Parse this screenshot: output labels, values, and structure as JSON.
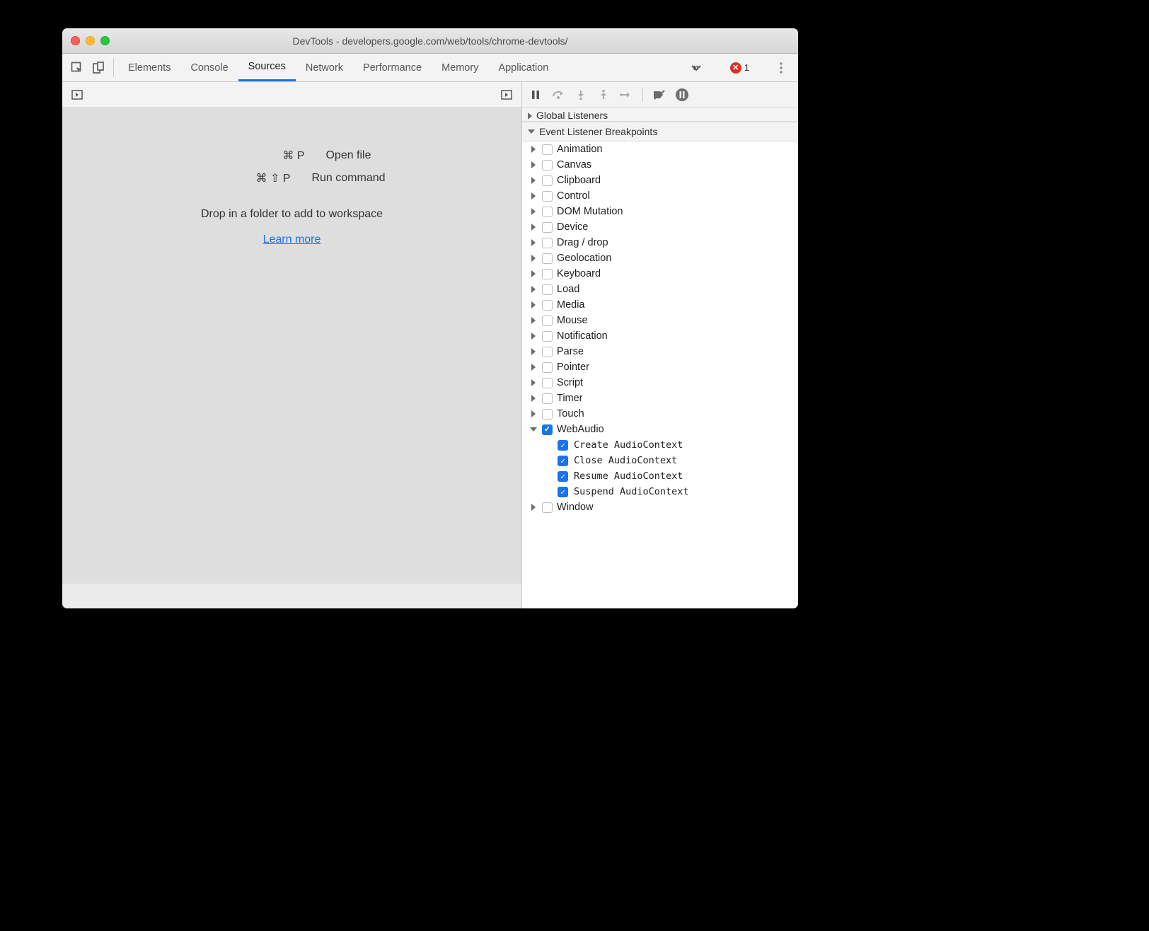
{
  "window_title": "DevTools - developers.google.com/web/tools/chrome-devtools/",
  "tabs": [
    "Elements",
    "Console",
    "Sources",
    "Network",
    "Performance",
    "Memory",
    "Application"
  ],
  "active_tab": "Sources",
  "error_count": "1",
  "shortcuts": [
    {
      "keys": "⌘ P",
      "action": "Open file"
    },
    {
      "keys": "⌘ ⇧ P",
      "action": "Run command"
    }
  ],
  "drop_text": "Drop in a folder to add to workspace",
  "learn_more": "Learn more",
  "sections": {
    "partial_header": "Global Listeners",
    "breakpoints_header": "Event Listener Breakpoints"
  },
  "categories": [
    {
      "label": "Animation",
      "expanded": false,
      "checked": false
    },
    {
      "label": "Canvas",
      "expanded": false,
      "checked": false
    },
    {
      "label": "Clipboard",
      "expanded": false,
      "checked": false
    },
    {
      "label": "Control",
      "expanded": false,
      "checked": false
    },
    {
      "label": "DOM Mutation",
      "expanded": false,
      "checked": false
    },
    {
      "label": "Device",
      "expanded": false,
      "checked": false
    },
    {
      "label": "Drag / drop",
      "expanded": false,
      "checked": false
    },
    {
      "label": "Geolocation",
      "expanded": false,
      "checked": false
    },
    {
      "label": "Keyboard",
      "expanded": false,
      "checked": false
    },
    {
      "label": "Load",
      "expanded": false,
      "checked": false
    },
    {
      "label": "Media",
      "expanded": false,
      "checked": false
    },
    {
      "label": "Mouse",
      "expanded": false,
      "checked": false
    },
    {
      "label": "Notification",
      "expanded": false,
      "checked": false
    },
    {
      "label": "Parse",
      "expanded": false,
      "checked": false
    },
    {
      "label": "Pointer",
      "expanded": false,
      "checked": false
    },
    {
      "label": "Script",
      "expanded": false,
      "checked": false
    },
    {
      "label": "Timer",
      "expanded": false,
      "checked": false
    },
    {
      "label": "Touch",
      "expanded": false,
      "checked": false
    },
    {
      "label": "WebAudio",
      "expanded": true,
      "checked": true,
      "children": [
        {
          "label": "Create AudioContext",
          "checked": true
        },
        {
          "label": "Close AudioContext",
          "checked": true
        },
        {
          "label": "Resume AudioContext",
          "checked": true
        },
        {
          "label": "Suspend AudioContext",
          "checked": true
        }
      ]
    },
    {
      "label": "Window",
      "expanded": false,
      "checked": false
    }
  ]
}
